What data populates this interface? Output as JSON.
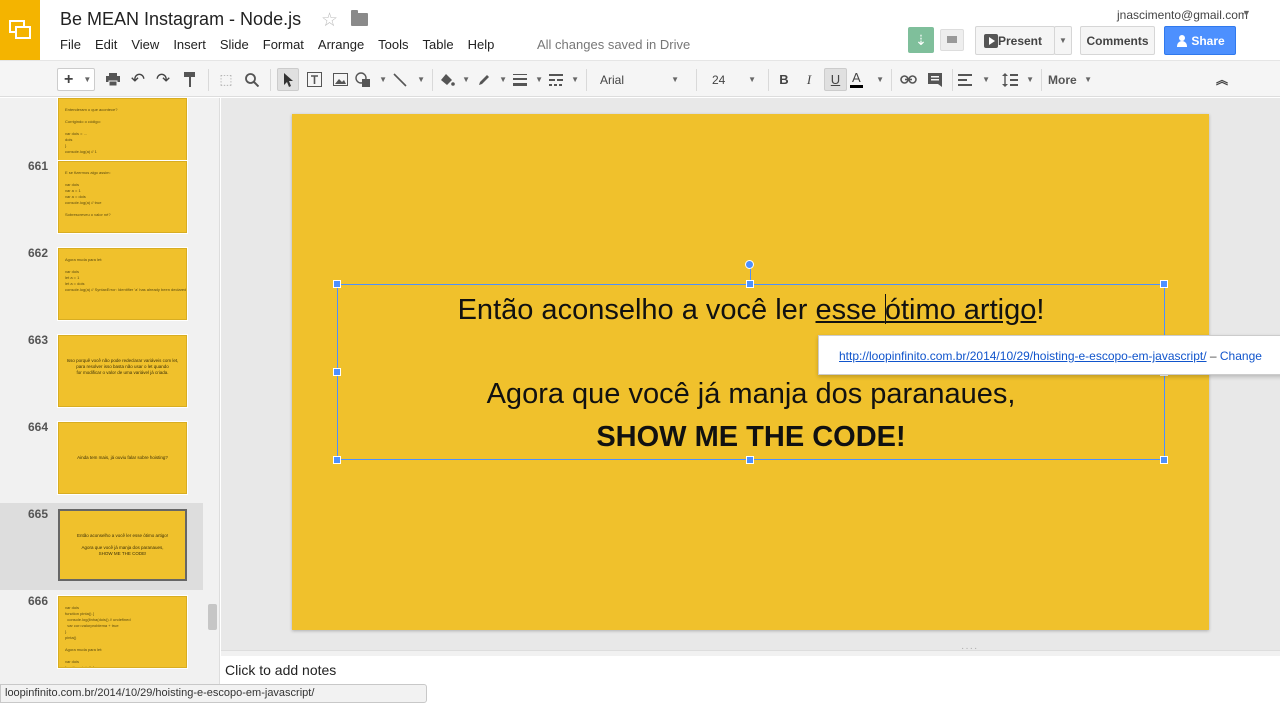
{
  "header": {
    "doc_title": "Be MEAN Instagram - Node.js",
    "save_status": "All changes saved in Drive",
    "account_email": "jnascimento@gmail.com",
    "menu": [
      "File",
      "Edit",
      "View",
      "Insert",
      "Slide",
      "Format",
      "Arrange",
      "Tools",
      "Table",
      "Help"
    ],
    "present_label": "Present",
    "comments_label": "Comments",
    "share_label": "Share"
  },
  "toolbar": {
    "font_name": "Arial",
    "font_size": "24",
    "more_label": "More",
    "icons": [
      "add-icon",
      "print-icon",
      "undo-icon",
      "redo-icon",
      "paint-format-icon",
      "select-icon",
      "zoom-icon",
      "cursor-icon",
      "text-box-icon",
      "image-icon",
      "shape-icon",
      "line-icon",
      "fill-color-icon",
      "border-color-icon",
      "border-weight-icon",
      "border-dash-icon",
      "bold-icon",
      "italic-icon",
      "underline-icon",
      "text-color-icon",
      "link-icon",
      "comment-icon",
      "align-icon",
      "line-spacing-icon",
      "collapse-icon"
    ]
  },
  "filmstrip": {
    "slides": [
      {
        "number": "",
        "kind": "lines",
        "text": "Entenderam o que acontece?\n\nCorrigindo o código:\n\nvar dois = ...\ndois\n}\nconsole.log(a) // 1"
      },
      {
        "number": "661",
        "kind": "lines",
        "text": "E se fizermos algo assim:\n\nvar dois\nvar a = 1\nvar a = dois\nconsole.log(a) // true\n\nSobrescreveu o valor né?"
      },
      {
        "number": "662",
        "kind": "lines",
        "text": "Agora muda para let:\n\nvar dois\nlet a = 1\nlet a = dois\nconsole.log(a) // SyntaxError: Identifier 'a' has already been declared"
      },
      {
        "number": "663",
        "kind": "center",
        "text": "Isso porquê você não pode redeclarar variáveis com let,\npara resolver isso basta não usar o let quando\nfor modificar o valor de uma variável já criada."
      },
      {
        "number": "664",
        "kind": "center",
        "text": "Ainda tem mais, já ouviu falar sobre hoisting?"
      },
      {
        "number": "665",
        "kind": "center",
        "text": "Então aconselho a você ler esse ótimo artigo!\n\nAgora que você já manja dos paranaues,\nSHOW ME THE CODE!"
      },
      {
        "number": "666",
        "kind": "lines",
        "text": "var dois\nfunction pinta() {\n  console.log(linha(dois)) // undefined\n  var cor=valorproblema + true\n}\npinta()\n\nAgora muda para let:\n\nvar dois\nfunction pinta() {\n  console.log(linha(dois)) // ReferenceError\n  let cor=valorproblema + true\n}\npinta()"
      }
    ],
    "selected_index": 5
  },
  "slide": {
    "line1_before": "Então aconselho a você ler ",
    "line1_link_a": "esse ",
    "line1_link_b": "ótimo artigo",
    "line1_after": "!",
    "line3": "Agora que você já manja dos paranaues,",
    "line4": "SHOW ME THE CODE!",
    "background_color": "#f0c12c"
  },
  "link_popup": {
    "url": "http://loopinfinito.com.br/2014/10/29/hoisting-e-escopo-em-javascript/",
    "separator": " – ",
    "change_label": "Change"
  },
  "notes": {
    "placeholder": "Click to add notes"
  },
  "status_bar": {
    "url": "loopinfinito.com.br/2014/10/29/hoisting-e-escopo-em-javascript/"
  }
}
